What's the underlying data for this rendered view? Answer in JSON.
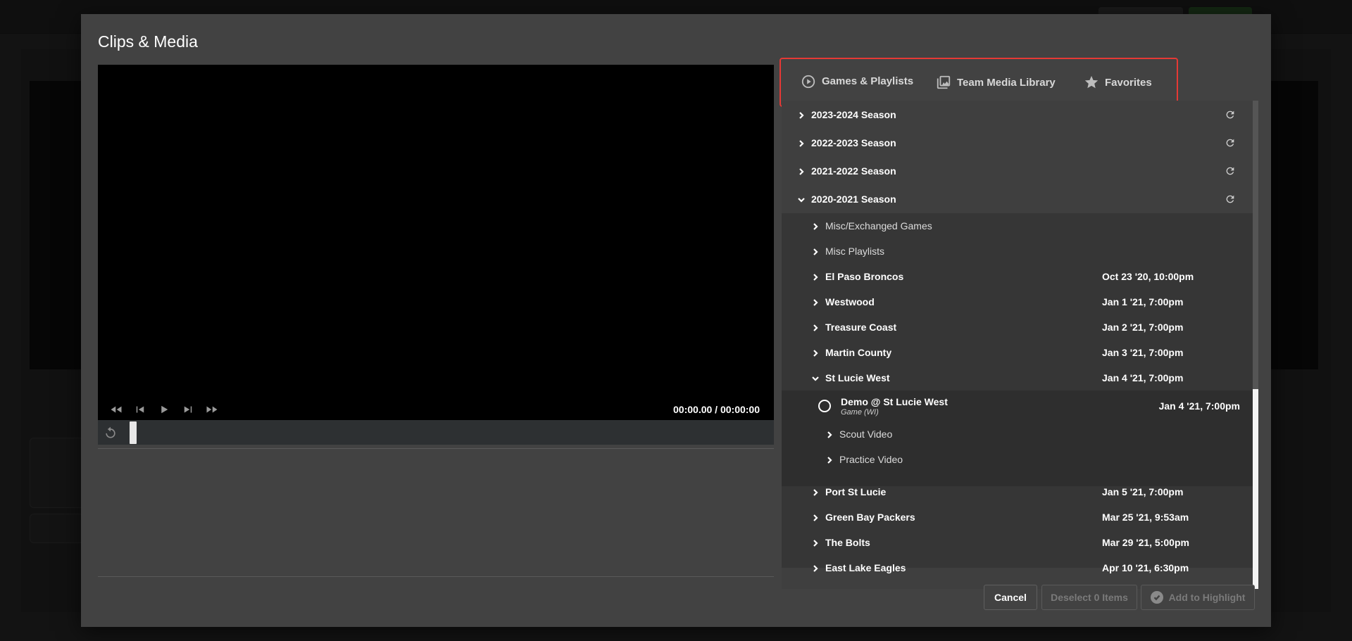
{
  "modal": {
    "title": "Clips & Media"
  },
  "player": {
    "timecode": "00:00.00 / 00:00:00",
    "controls": [
      "rewind-icon",
      "step-back-icon",
      "play-icon",
      "step-forward-icon",
      "fast-forward-icon"
    ]
  },
  "tabs": [
    {
      "label": "Games & Playlists",
      "icon": "play-circle-icon",
      "active": true
    },
    {
      "label": "Team Media Library",
      "icon": "media-library-icon",
      "active": false
    },
    {
      "label": "Favorites",
      "icon": "star-icon",
      "active": false
    }
  ],
  "seasons": [
    {
      "label": "2023-2024 Season",
      "expanded": false
    },
    {
      "label": "2022-2023 Season",
      "expanded": false
    },
    {
      "label": "2021-2022 Season",
      "expanded": false
    },
    {
      "label": "2020-2021 Season",
      "expanded": true
    }
  ],
  "season_items": [
    {
      "label": "Misc/Exchanged Games",
      "date": ""
    },
    {
      "label": "Misc Playlists",
      "date": ""
    },
    {
      "label": "El Paso Broncos",
      "date": "Oct 23 '20, 10:00pm"
    },
    {
      "label": "Westwood",
      "date": "Jan 1 '21, 7:00pm"
    },
    {
      "label": "Treasure Coast",
      "date": "Jan 2 '21, 7:00pm"
    },
    {
      "label": "Martin County",
      "date": "Jan 3 '21, 7:00pm"
    },
    {
      "label": "St Lucie West",
      "date": "Jan 4 '21, 7:00pm"
    }
  ],
  "expanded_game": {
    "title": "Demo @ St Lucie West",
    "subtitle": "Game (WI)",
    "date": "Jan 4 '21, 7:00pm",
    "children": [
      "Scout Video",
      "Practice Video"
    ]
  },
  "more_items": [
    {
      "label": "Port St Lucie",
      "date": "Jan 5 '21, 7:00pm"
    },
    {
      "label": "Green Bay Packers",
      "date": "Mar 25 '21, 9:53am"
    },
    {
      "label": "The Bolts",
      "date": "Mar 29 '21, 5:00pm"
    },
    {
      "label": "East Lake Eagles",
      "date": "Apr 10 '21, 6:30pm"
    }
  ],
  "buttons": {
    "cancel": "Cancel",
    "deselect": "Deselect 0 Items",
    "add": "Add to Highlight"
  },
  "colors": {
    "accent_green": "#2e9e3a",
    "highlight_red": "#e53935",
    "modal_bg": "#424242"
  }
}
